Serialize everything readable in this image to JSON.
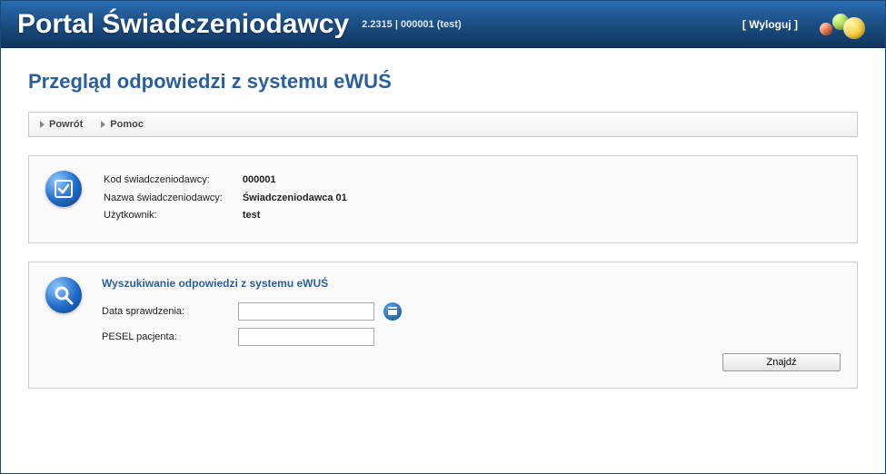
{
  "header": {
    "title": "Portal Świadczeniodawcy",
    "version": "2.2315 | 000001 (test)",
    "logout_label": "[ Wyloguj ]"
  },
  "page_title": "Przegląd odpowiedzi z systemu eWUŚ",
  "toolbar": {
    "back_label": "Powrót",
    "help_label": "Pomoc"
  },
  "provider": {
    "code_label": "Kod świadczeniodawcy:",
    "code_value": "000001",
    "name_label": "Nazwa świadczeniodawcy:",
    "name_value": "Świadczeniodawca 01",
    "user_label": "Użytkownik:",
    "user_value": "test"
  },
  "search": {
    "title": "Wyszukiwanie odpowiedzi z systemu eWUŚ",
    "date_label": "Data sprawdzenia:",
    "date_value": "",
    "pesel_label": "PESEL pacjenta:",
    "pesel_value": "",
    "submit_label": "Znajdź"
  }
}
